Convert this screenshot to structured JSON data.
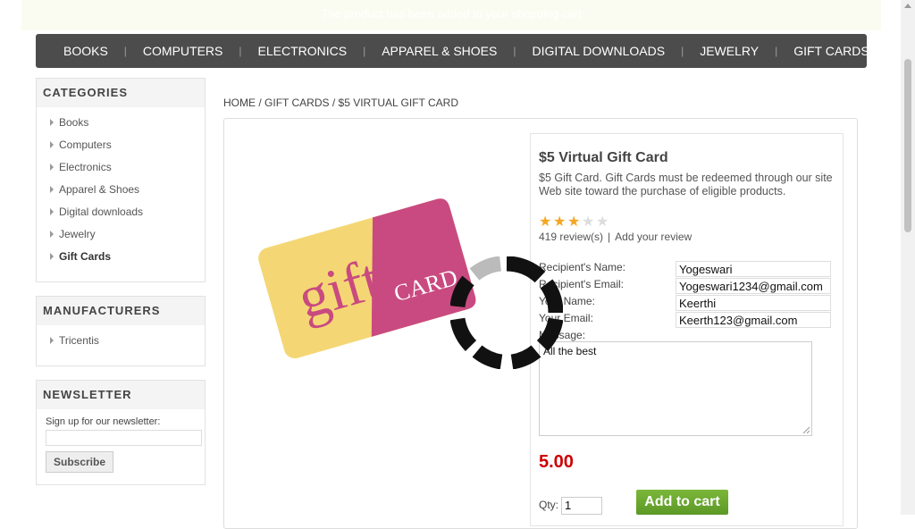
{
  "topbar": {
    "notice": "The product has been added to your shopping cart"
  },
  "nav": {
    "items": [
      "BOOKS",
      "COMPUTERS",
      "ELECTRONICS",
      "APPAREL & SHOES",
      "DIGITAL DOWNLOADS",
      "JEWELRY",
      "GIFT CARDS"
    ],
    "separator": "|"
  },
  "sidebar": {
    "categories": {
      "title": "CATEGORIES",
      "items": [
        "Books",
        "Computers",
        "Electronics",
        "Apparel & Shoes",
        "Digital downloads",
        "Jewelry",
        "Gift Cards"
      ],
      "active": "Gift Cards"
    },
    "manufacturers": {
      "title": "MANUFACTURERS",
      "items": [
        "Tricentis"
      ]
    },
    "newsletter": {
      "title": "NEWSLETTER",
      "label": "Sign up for our newsletter:",
      "input_value": "",
      "button": "Subscribe"
    }
  },
  "breadcrumb": {
    "home": "HOME",
    "sep": "/",
    "category": "GIFT CARDS",
    "current": "$5 VIRTUAL GIFT CARD"
  },
  "product": {
    "image_alt": "gift CARD",
    "image_word1": "gift",
    "image_word2": "CARD",
    "name": "$5 Virtual Gift Card",
    "description": "$5 Gift Card. Gift Cards must be redeemed through our site Web site toward the purchase of eligible products.",
    "rating": 3,
    "rating_max": 5,
    "reviews_text": "419 review(s)",
    "review_sep": "|",
    "add_review": "Add your review",
    "price": "5.00"
  },
  "form": {
    "recipient_name_label": "Recipient's Name:",
    "recipient_name_value": "Yogeswari",
    "recipient_email_label": "Recipient's Email:",
    "recipient_email_value": "Yogeswari1234@gmail.com",
    "your_name_label": "Your Name:",
    "your_name_value": "Keerthi",
    "your_email_label": "Your Email:",
    "your_email_value": "Keerth123@gmail.com",
    "message_label": "Message:",
    "message_value": "All the best",
    "qty_label": "Qty:",
    "qty_value": "1",
    "add_to_cart": "Add to cart"
  },
  "colors": {
    "nav_bg": "#4c4c4c",
    "price": "#cc0000",
    "add_to_cart": "#69a82f",
    "card_yellow": "#f4d774",
    "card_pink": "#c94a80",
    "star_on": "#f5a623"
  },
  "icons": {
    "spinner": "loading-spinner-icon",
    "arrow": "triangle-right-icon"
  }
}
